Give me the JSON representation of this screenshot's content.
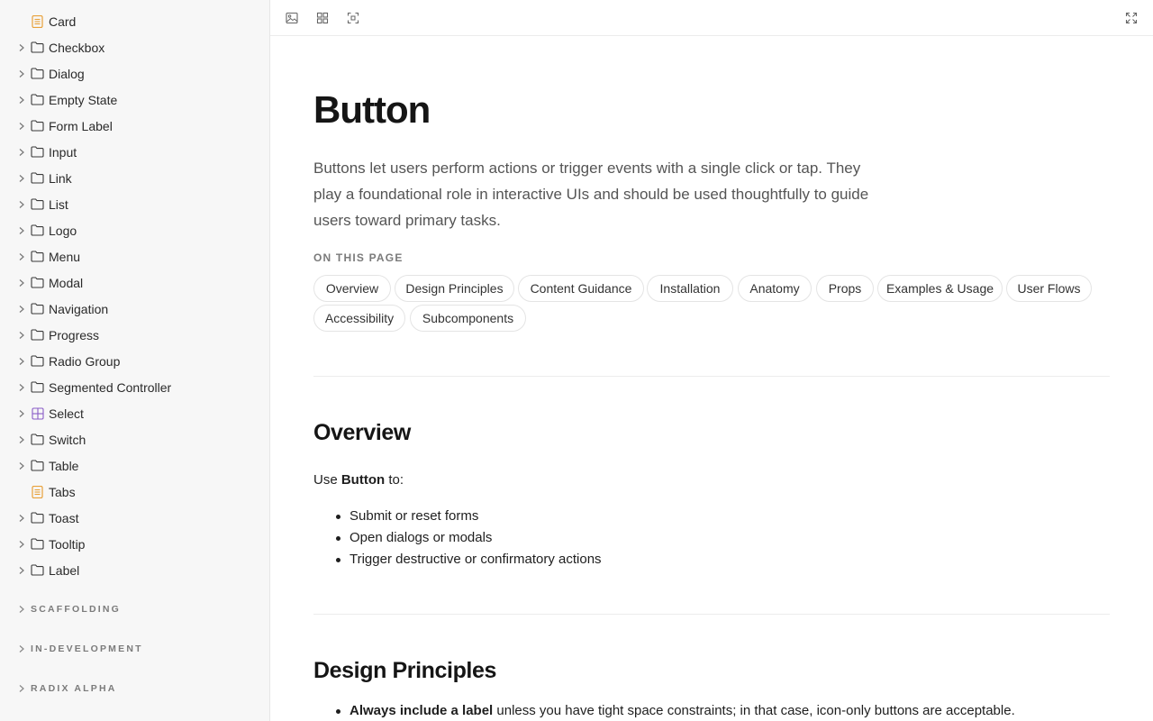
{
  "sidebar": {
    "items": [
      {
        "label": "Card",
        "icon": "document-icon",
        "expandable": false
      },
      {
        "label": "Checkbox",
        "icon": "folder-icon",
        "expandable": true
      },
      {
        "label": "Dialog",
        "icon": "folder-icon",
        "expandable": true
      },
      {
        "label": "Empty State",
        "icon": "folder-icon",
        "expandable": true
      },
      {
        "label": "Form Label",
        "icon": "folder-icon",
        "expandable": true
      },
      {
        "label": "Input",
        "icon": "folder-icon",
        "expandable": true
      },
      {
        "label": "Link",
        "icon": "folder-icon",
        "expandable": true
      },
      {
        "label": "List",
        "icon": "folder-icon",
        "expandable": true
      },
      {
        "label": "Logo",
        "icon": "folder-icon",
        "expandable": true
      },
      {
        "label": "Menu",
        "icon": "folder-icon",
        "expandable": true
      },
      {
        "label": "Modal",
        "icon": "folder-icon",
        "expandable": true
      },
      {
        "label": "Navigation",
        "icon": "folder-icon",
        "expandable": true
      },
      {
        "label": "Progress",
        "icon": "folder-icon",
        "expandable": true
      },
      {
        "label": "Radio Group",
        "icon": "folder-icon",
        "expandable": true
      },
      {
        "label": "Segmented Controller",
        "icon": "folder-icon",
        "expandable": true
      },
      {
        "label": "Select",
        "icon": "grid-board-icon",
        "expandable": true
      },
      {
        "label": "Switch",
        "icon": "folder-icon",
        "expandable": true
      },
      {
        "label": "Table",
        "icon": "folder-icon",
        "expandable": true
      },
      {
        "label": "Tabs",
        "icon": "document-icon",
        "expandable": false
      },
      {
        "label": "Toast",
        "icon": "folder-icon",
        "expandable": true
      },
      {
        "label": "Tooltip",
        "icon": "folder-icon",
        "expandable": true
      },
      {
        "label": "Label",
        "icon": "folder-icon",
        "expandable": true
      }
    ],
    "sections": [
      {
        "label": "SCAFFOLDING"
      },
      {
        "label": "IN-DEVELOPMENT"
      },
      {
        "label": "RADIX ALPHA"
      }
    ]
  },
  "toolbar": {
    "icons": [
      "image-icon",
      "grid-icon",
      "select-frame-icon",
      "expand-icon"
    ]
  },
  "page": {
    "title": "Button",
    "lede": "Buttons let users perform actions or trigger events with a single click or tap. They play a foundational role in interactive UIs and should be used thoughtfully to guide users toward primary tasks.",
    "on_this_page_label": "ON THIS PAGE",
    "chips": [
      "Overview",
      "Design Principles",
      "Content Guidance",
      "Installation",
      "Anatomy",
      "Props",
      "Examples & Usage",
      "User Flows",
      "Accessibility",
      "Subcomponents"
    ],
    "overview": {
      "heading": "Overview",
      "intro_prefix": "Use ",
      "intro_bold": "Button",
      "intro_suffix": " to:",
      "bullets": [
        "Submit or reset forms",
        "Open dialogs or modals",
        "Trigger destructive or confirmatory actions"
      ]
    },
    "design_principles": {
      "heading": "Design Principles",
      "first_bold": "Always include a label",
      "first_rest": " unless you have tight space constraints; in that case, icon-only buttons are acceptable."
    }
  },
  "colors": {
    "folder_icon": "#3a3a3a",
    "document_icon": "#e8a13a",
    "grid_board_icon": "#8a5cc7",
    "sidebar_bg": "#f7f7f7"
  }
}
